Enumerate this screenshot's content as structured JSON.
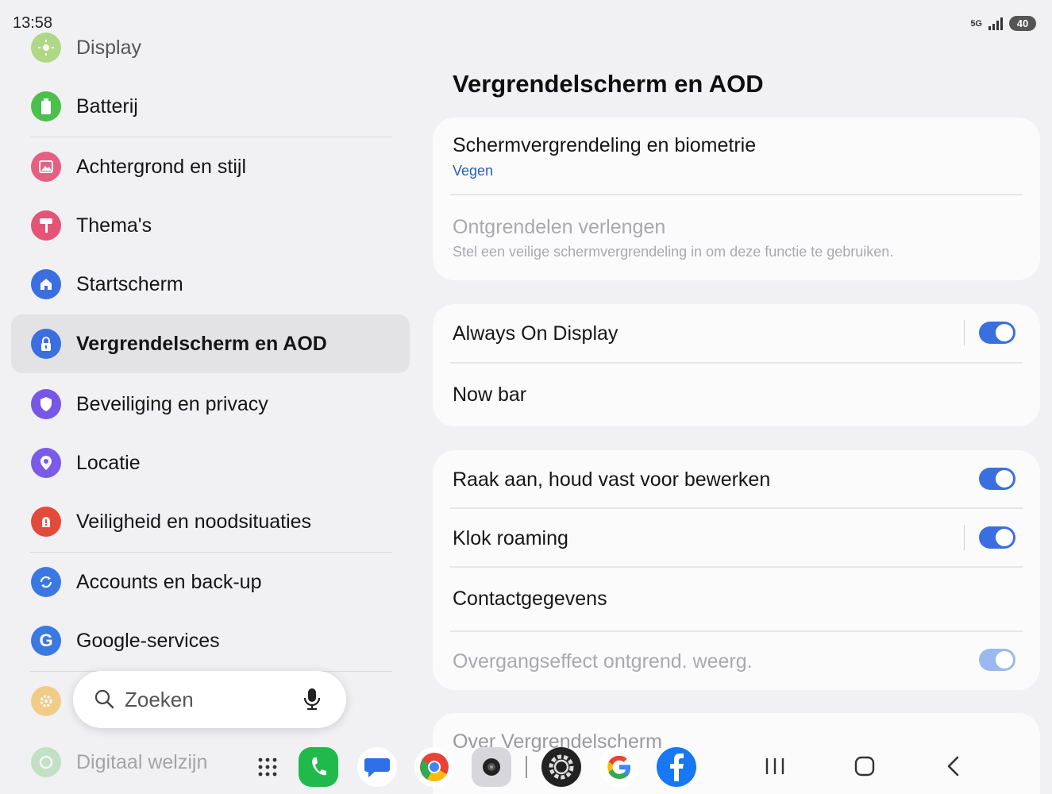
{
  "status_bar": {
    "time": "13:58",
    "network": "5G",
    "battery": "40"
  },
  "sidebar": {
    "items": [
      {
        "label": "Display",
        "icon": "sun-icon",
        "color": "#9ed36a"
      },
      {
        "label": "Batterij",
        "icon": "battery-icon",
        "color": "#4cbf4c"
      },
      {
        "label": "Achtergrond en stijl",
        "icon": "image-icon",
        "color": "#e55f82"
      },
      {
        "label": "Thema's",
        "icon": "paint-roller-icon",
        "color": "#e55476"
      },
      {
        "label": "Startscherm",
        "icon": "home-icon",
        "color": "#3b6fe0"
      },
      {
        "label": "Vergrendelscherm en AOD",
        "icon": "lock-icon",
        "color": "#3b6fe0"
      },
      {
        "label": "Beveiliging en privacy",
        "icon": "shield-icon",
        "color": "#7757e6"
      },
      {
        "label": "Locatie",
        "icon": "location-icon",
        "color": "#7b5ae8"
      },
      {
        "label": "Veiligheid en noodsituaties",
        "icon": "alert-icon",
        "color": "#e24b3c"
      },
      {
        "label": "Accounts en back-up",
        "icon": "sync-icon",
        "color": "#3b79e2"
      },
      {
        "label": "Google-services",
        "icon": "google-g-icon",
        "color": "#3b79e2"
      },
      {
        "label": "",
        "icon": "gear-icon",
        "color": "#f2b544"
      },
      {
        "label": "Digitaal welzijn",
        "icon": "wellbeing-icon",
        "color": "#6cc36c"
      }
    ],
    "selected": "Vergrendelscherm en AOD"
  },
  "search": {
    "label": "Zoeken"
  },
  "main": {
    "title": "Vergrendelscherm en AOD",
    "groups": [
      {
        "rows": [
          {
            "title": "Schermvergrendeling en biometrie",
            "subtitle": "Vegen"
          },
          {
            "title": "Ontgrendelen verlengen",
            "subtitle": "Stel een veilige schermvergrendeling in om deze functie te gebruiken."
          }
        ]
      },
      {
        "rows": [
          {
            "title": "Always On Display",
            "toggle": true
          },
          {
            "title": "Now bar"
          }
        ]
      },
      {
        "rows": [
          {
            "title": "Raak aan, houd vast voor bewerken",
            "toggle": true
          },
          {
            "title": "Klok roaming",
            "toggle": true
          },
          {
            "title": "Contactgegevens"
          },
          {
            "title": "Overgangseffect ontgrend. weerg.",
            "toggle": true
          }
        ]
      },
      {
        "rows": [
          {
            "title": "Over Vergrendelscherm"
          }
        ]
      }
    ]
  },
  "taskbar": {
    "apps": [
      "apps-grid-icon",
      "phone-icon",
      "messages-icon",
      "chrome-icon",
      "camera-icon",
      "settings-icon",
      "google-icon",
      "facebook-icon"
    ],
    "nav": [
      "recent-apps-icon",
      "home-button-icon",
      "back-icon"
    ]
  },
  "colors": {
    "accent": "#3b6fe0",
    "background": "#f1f1f3",
    "card": "#fbfbfc"
  }
}
